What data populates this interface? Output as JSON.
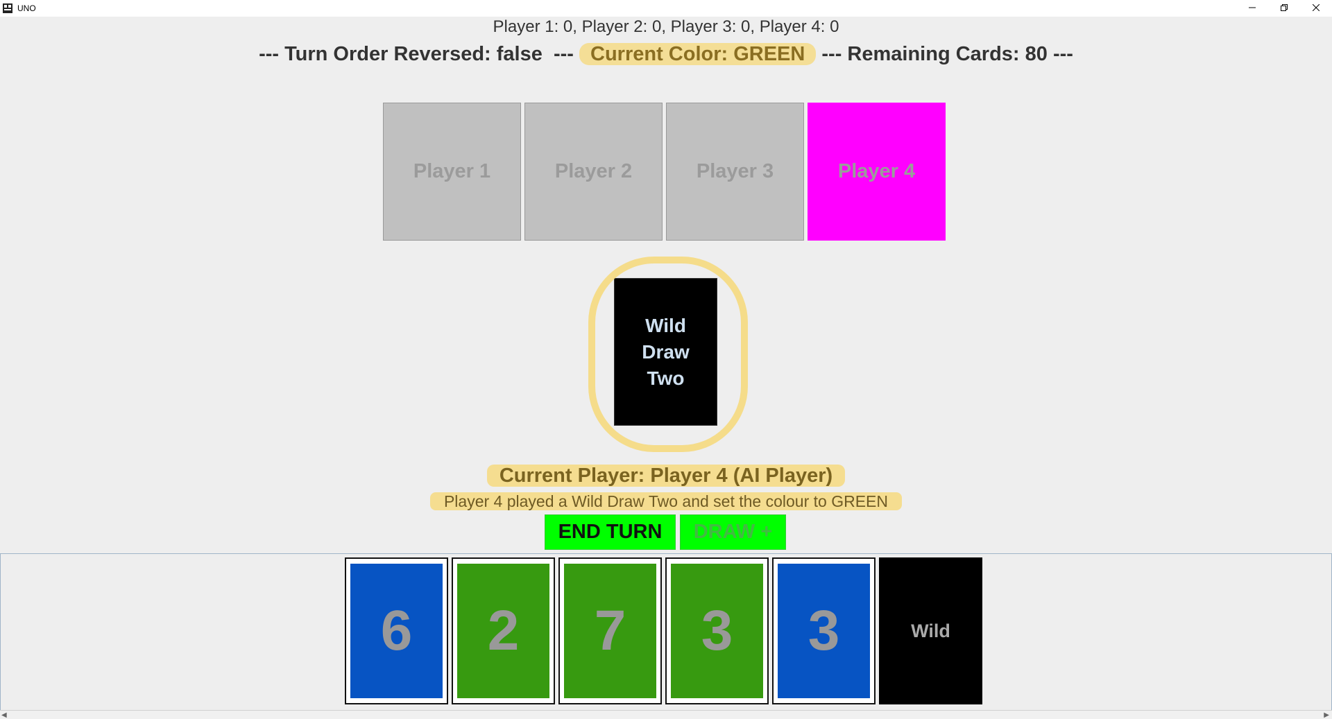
{
  "window": {
    "title": "UNO",
    "icons": {
      "app": "app-icon",
      "minimize": "minimize-icon",
      "restore": "restore-icon",
      "close": "close-icon"
    }
  },
  "scores": "Player 1: 0, Player 2: 0, Player 3: 0, Player 4: 0",
  "status": {
    "part1": "--- Turn Order Reversed: false  --- ",
    "current_color": "Current Color: GREEN",
    "part2": " --- Remaining Cards: 80 ---"
  },
  "players": [
    {
      "label": "Player 1",
      "active": false
    },
    {
      "label": "Player 2",
      "active": false
    },
    {
      "label": "Player 3",
      "active": false
    },
    {
      "label": "Player 4",
      "active": true
    }
  ],
  "colors": {
    "active_player": "#ff00ff",
    "inactive_player": "#c0c0c0",
    "button": "#00ff00",
    "blue_card": "#0754c3",
    "green_card": "#379a10",
    "black_card": "#000000",
    "highlight": "#f6d878"
  },
  "discard": {
    "label": "Wild\nDraw\nTwo",
    "color": "black"
  },
  "current_player": "Current Player: Player 4 (AI Player)",
  "message": "Player 4 played a Wild Draw Two and set the colour to GREEN",
  "buttons": {
    "end_turn": "END TURN",
    "draw": "DRAW +"
  },
  "hand": [
    {
      "label": "6",
      "color": "blue"
    },
    {
      "label": "2",
      "color": "green"
    },
    {
      "label": "7",
      "color": "green"
    },
    {
      "label": "3",
      "color": "green"
    },
    {
      "label": "3",
      "color": "blue"
    },
    {
      "label": "Wild",
      "color": "black"
    }
  ]
}
